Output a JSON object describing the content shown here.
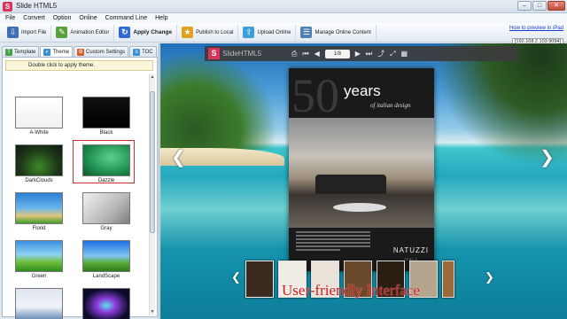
{
  "window": {
    "title": "Slide HTML5",
    "app_icon": "S",
    "minimize": "–",
    "maximize": "□",
    "close": "✕"
  },
  "menu": [
    "File",
    "Convert",
    "Option",
    "Online",
    "Command Line",
    "Help"
  ],
  "toolbar": {
    "buttons": [
      {
        "label": "Import File",
        "icon": "import-icon",
        "color": "#3f6fb6"
      },
      {
        "label": "Animation Editor",
        "icon": "animation-icon",
        "color": "#5aa03a"
      },
      {
        "label": "Apply Change",
        "icon": "apply-icon",
        "color": "#2f6bd0"
      },
      {
        "label": "Publish to Local",
        "icon": "publish-icon",
        "color": "#e0a020"
      },
      {
        "label": "Upload Online",
        "icon": "upload-icon",
        "color": "#3d9fd8"
      },
      {
        "label": "Manage Online Content",
        "icon": "manage-icon",
        "color": "#4f7fb5"
      }
    ],
    "preview_link": "How to preview in iPad",
    "preview_ip": "[192.168.2.103:9094]"
  },
  "left_panel": {
    "tabs": [
      {
        "label": "Template",
        "color": "#4aa04a"
      },
      {
        "label": "Theme",
        "color": "#3b8fd6"
      },
      {
        "label": "Custom Settings",
        "color": "#d85a2a"
      },
      {
        "label": "TOC",
        "color": "#3b8fd6"
      }
    ],
    "hint": "Double click to apply theme.",
    "themes": [
      {
        "name": "A-White",
        "fill": "linear-gradient(#ffffff,#f1f1f1)"
      },
      {
        "name": "Black",
        "fill": "linear-gradient(#111,#000)"
      },
      {
        "name": "DarkClouds",
        "fill": "radial-gradient(ellipse at 50% 70%, #3d8a2a 0%, #1f3a18 55%, #0e1a10 100%)"
      },
      {
        "name": "Dazzle",
        "fill": "radial-gradient(ellipse at 60% 40%, #5ed18d 0%, #1f8e4f 60%, #0f5a2e 100%)"
      },
      {
        "name": "Florid",
        "fill": "linear-gradient(#2b7fd4 0%, #6bb6ea 50%, #e2c47d 75%, #3d9e2e 100%)"
      },
      {
        "name": "Gray",
        "fill": "linear-gradient(135deg, #f1f1f1 0%, #b8b8b8 60%, #7e7e7e 100%)"
      },
      {
        "name": "Green",
        "fill": "linear-gradient(#3b8fe0 0%, #8ed2f5 45%, #6fbf3a 70%, #2e8b1e 100%)"
      },
      {
        "name": "LandScape",
        "fill": "linear-gradient(#1f6fe0 0%, #7fc4f3 50%, #58b038 72%, #2e7a1c 100%)"
      },
      {
        "name": "",
        "fill": "linear-gradient(#dfe6f0 0%, #eef2f8 60%, #6f8fb8 100%)"
      },
      {
        "name": "",
        "fill": "radial-gradient(ellipse at 50% 55%, #5ee0f0 0%, #8a3ad8 30%, #0c0c2a 70%)"
      }
    ],
    "selected_theme": "Dazzle"
  },
  "preview": {
    "logo_letter": "S",
    "logo_text": "SlideHTML5",
    "page": "1/8",
    "book": {
      "fifty": "50",
      "years": "years",
      "subtitle": "of italian design",
      "brand": "NATUZZI",
      "country": "ITALY"
    },
    "caption": "User-friendly Interface",
    "thumbs": [
      "#3a2a20",
      "#f0ece6",
      "#e9e3da",
      "#6a4a2a",
      "#2a1d12",
      "#b5a58f",
      "#9a6a3a"
    ]
  }
}
